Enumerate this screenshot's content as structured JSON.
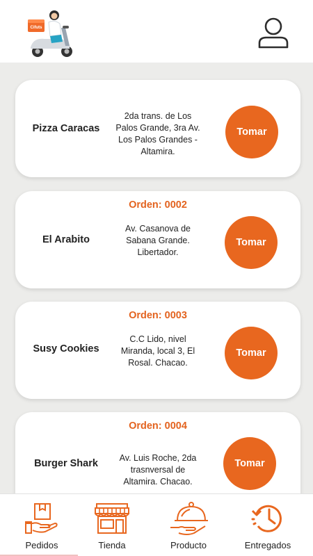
{
  "colors": {
    "accent": "#e8671f",
    "background": "#ececea"
  },
  "header": {
    "logo_icon": "scooter-delivery-logo",
    "logo_box_text": "Cifuts",
    "profile_icon": "user-icon"
  },
  "orders": [
    {
      "order_label": "",
      "store": "Pizza Caracas",
      "address": "2da trans. de Los Palos Grande, 3ra Av. Los Palos Grandes - Altamira.",
      "button": "Tomar"
    },
    {
      "order_label": "Orden: 0002",
      "store": "El Arabito",
      "address": "Av. Casanova de Sabana Grande. Libertador.",
      "button": "Tomar"
    },
    {
      "order_label": "Orden: 0003",
      "store": "Susy Cookies",
      "address": "C.C Lido, nivel Miranda, local 3, El Rosal. Chacao.",
      "button": "Tomar"
    },
    {
      "order_label": "Orden: 0004",
      "store": "Burger Shark",
      "address": "Av. Luis Roche, 2da trasnversal de Altamira. Chacao.",
      "button": "Tomar"
    }
  ],
  "nav": [
    {
      "label": "Pedidos",
      "icon": "box-hand-icon"
    },
    {
      "label": "Tienda",
      "icon": "store-icon"
    },
    {
      "label": "Producto",
      "icon": "food-cloche-icon"
    },
    {
      "label": "Entregados",
      "icon": "history-clock-icon"
    }
  ]
}
